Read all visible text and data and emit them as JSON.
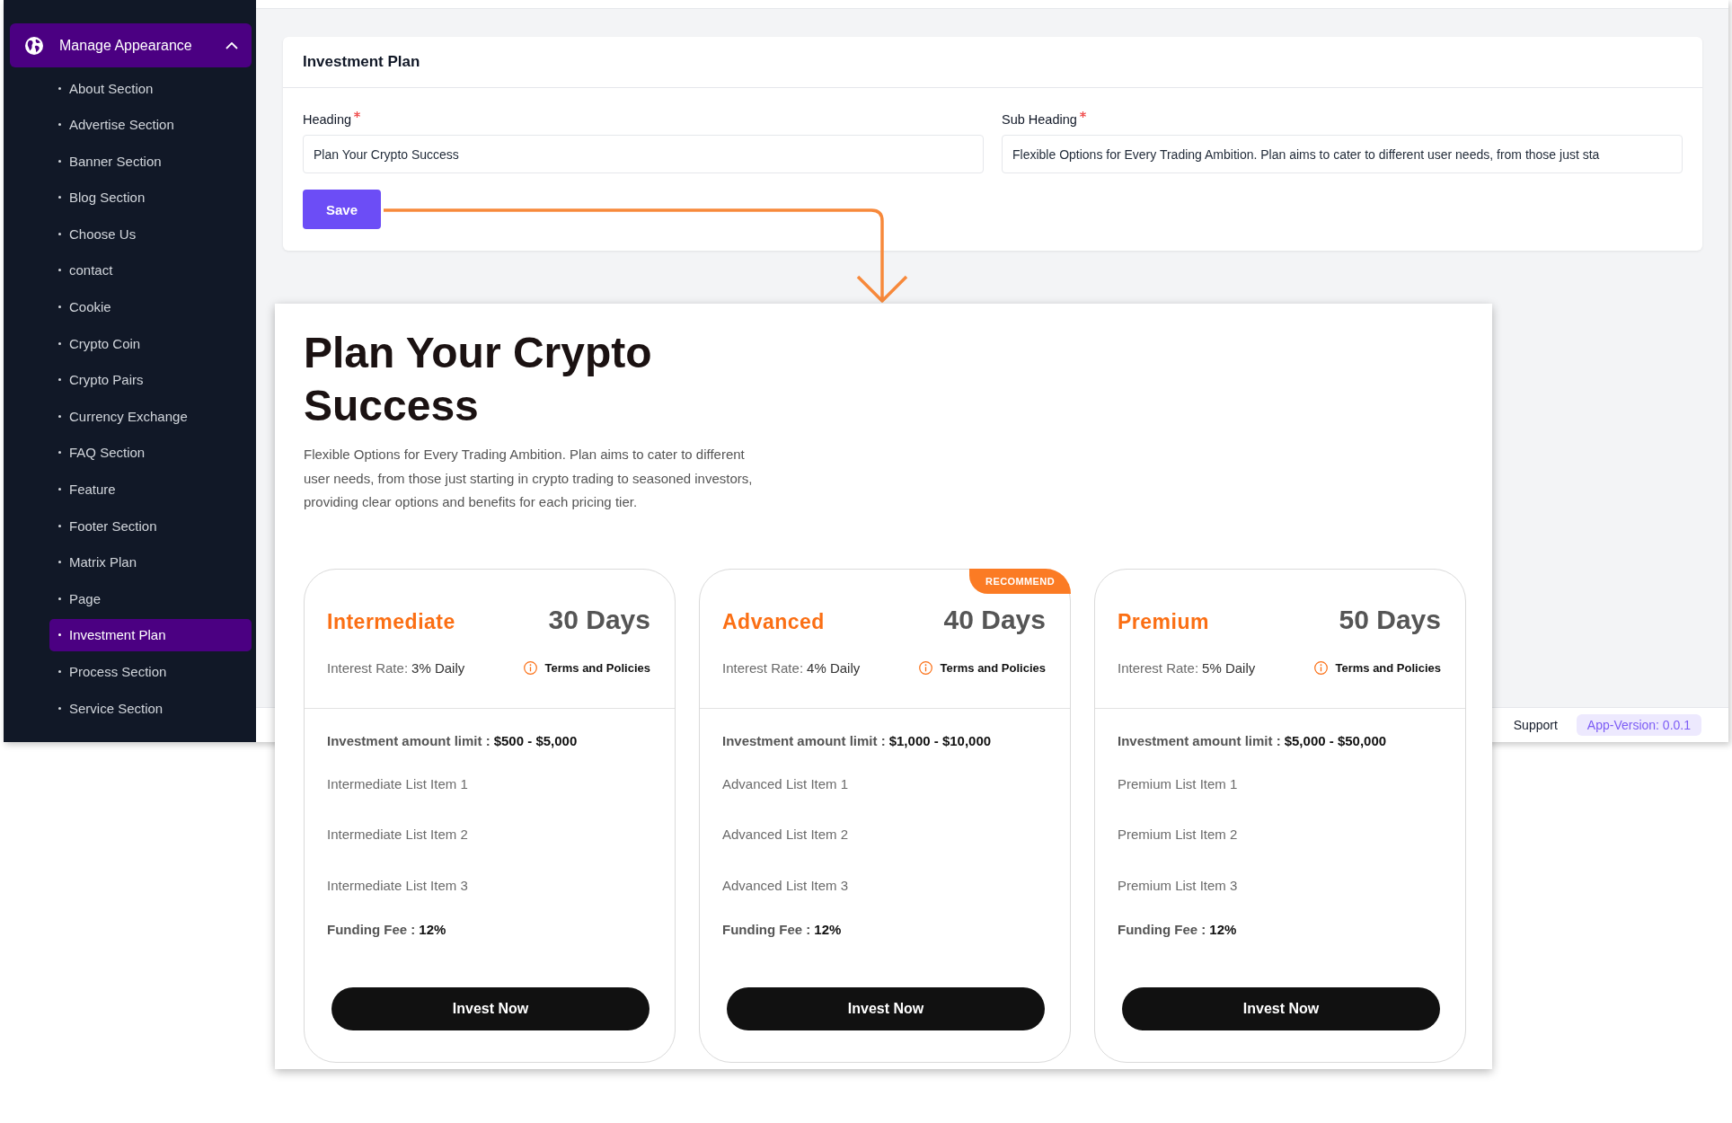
{
  "sidebar": {
    "group": {
      "label": "Manage Appearance",
      "active": true,
      "expanded": true
    },
    "items": [
      {
        "label": "About Section",
        "selected": false
      },
      {
        "label": "Advertise Section",
        "selected": false
      },
      {
        "label": "Banner Section",
        "selected": false
      },
      {
        "label": "Blog Section",
        "selected": false
      },
      {
        "label": "Choose Us",
        "selected": false
      },
      {
        "label": "contact",
        "selected": false
      },
      {
        "label": "Cookie",
        "selected": false
      },
      {
        "label": "Crypto Coin",
        "selected": false
      },
      {
        "label": "Crypto Pairs",
        "selected": false
      },
      {
        "label": "Currency Exchange",
        "selected": false
      },
      {
        "label": "FAQ Section",
        "selected": false
      },
      {
        "label": "Feature",
        "selected": false
      },
      {
        "label": "Footer Section",
        "selected": false
      },
      {
        "label": "Matrix Plan",
        "selected": false
      },
      {
        "label": "Page",
        "selected": false
      },
      {
        "label": "Investment Plan",
        "selected": true
      },
      {
        "label": "Process Section",
        "selected": false
      },
      {
        "label": "Service Section",
        "selected": false
      }
    ]
  },
  "form": {
    "title": "Investment Plan",
    "fields": [
      {
        "label": "Heading",
        "required": true,
        "value": "Plan Your Crypto Success"
      },
      {
        "label": "Sub Heading",
        "required": true,
        "value": "Flexible Options for Every Trading Ambition. Plan aims to cater to different user needs, from those just sta"
      }
    ],
    "save_button": "Save"
  },
  "footer": {
    "link": "Support",
    "version": "App-Version: 0.0.1"
  },
  "preview": {
    "title": "Plan Your Crypto Success",
    "description": "Flexible Options for Every Trading Ambition. Plan aims to cater to different user needs, from those just starting in crypto trading to seasoned investors, providing clear options and benefits for each pricing tier.",
    "plans": [
      {
        "name": "Intermediate",
        "duration": "30 Days",
        "interest_label": "Interest Rate:",
        "interest_value": "3% Daily",
        "terms_link": "Terms and Policies",
        "limit_label": "Investment amount limit :",
        "limit_value": "$500 - $5,000",
        "features": [
          "Intermediate List Item 1",
          "Intermediate List Item 2",
          "Intermediate List Item 3"
        ],
        "fee_label": "Funding Fee :",
        "fee_value": "12%",
        "button": "Invest Now"
      },
      {
        "name": "Advanced",
        "badge": "RECOMMEND",
        "duration": "40 Days",
        "interest_label": "Interest Rate:",
        "interest_value": "4% Daily",
        "terms_link": "Terms and Policies",
        "limit_label": "Investment amount limit :",
        "limit_value": "$1,000 - $10,000",
        "features": [
          "Advanced List Item 1",
          "Advanced List Item 2",
          "Advanced List Item 3"
        ],
        "fee_label": "Funding Fee :",
        "fee_value": "12%",
        "button": "Invest Now"
      },
      {
        "name": "Premium",
        "duration": "50 Days",
        "interest_label": "Interest Rate:",
        "interest_value": "5% Daily",
        "terms_link": "Terms and Policies",
        "limit_label": "Investment amount limit :",
        "limit_value": "$5,000 - $50,000",
        "features": [
          "Premium List Item 1",
          "Premium List Item 2",
          "Premium List Item 3"
        ],
        "fee_label": "Funding Fee :",
        "fee_value": "12%",
        "button": "Invest Now"
      }
    ]
  }
}
